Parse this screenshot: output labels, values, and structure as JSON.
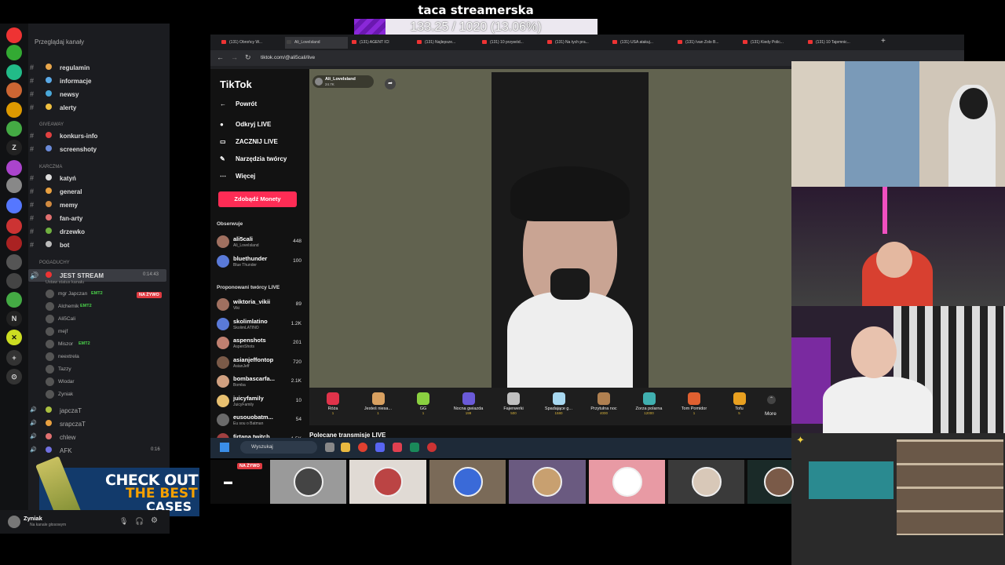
{
  "goal": {
    "title": "taca streamerska",
    "text": "133.25 / 1020 (13.06%)",
    "fraction": 0.1306
  },
  "discord": {
    "browse": "Przeglądaj kanały",
    "channels": [
      {
        "label": "regulamin",
        "color": "#e8a64b"
      },
      {
        "label": "informacje",
        "color": "#5aa9e6"
      },
      {
        "label": "newsy",
        "color": "#4aa8d8"
      },
      {
        "label": "alerty",
        "color": "#f0c040"
      }
    ],
    "cat_giveaway": "GIVEAWAY",
    "giveaway": [
      {
        "label": "konkurs-info",
        "color": "#e04040"
      },
      {
        "label": "screenshoty",
        "color": "#6a8ad8"
      }
    ],
    "cat_karczma": "KARCZMA",
    "karczma": [
      {
        "label": "katyń",
        "color": "#dddddd"
      },
      {
        "label": "general",
        "color": "#e8a040"
      },
      {
        "label": "memy",
        "color": "#d08a40"
      },
      {
        "label": "fan-arty",
        "color": "#e07070"
      },
      {
        "label": "drzewko",
        "color": "#70b040"
      },
      {
        "label": "bot",
        "color": "#bbbbbb"
      }
    ],
    "cat_pogaduchy": "POGADUCHY",
    "voice_active": "JEST STREAM",
    "voice_active_sub": "Ustaw status kanału",
    "voice_time": "0:14:43",
    "live_badge": "NA ŻYWO",
    "voice_users": [
      "mgr Japczan",
      "Alchemik",
      "Ali5Cali",
      "mejf",
      "Miszor",
      "neextrela",
      "Tazzy",
      "Wlodar",
      "Zyniak"
    ],
    "emt": "EMT2",
    "voice_others": [
      "japczaT",
      "srapczaT",
      "chlew",
      "AFK"
    ],
    "afk_time": "0:16",
    "user_name": "Zyniak",
    "user_status": "Na kanale głosowym"
  },
  "browser": {
    "tabs": [
      "(131) Obrońcy W...",
      "Ali_LoveIsland",
      "(131) AGENT ICI",
      "(131) Najlepsze...",
      "(131) 10 przywód...",
      "(131) Na tych pra...",
      "(131) USA atakuj...",
      "(131) Ivan Zolo B...",
      "(131) Kiedy Polic...",
      "(131) 10 Tajemnic..."
    ],
    "url": "tiktok.com/@ali5cali/live"
  },
  "tiktok": {
    "logo": "TikTok",
    "nav": [
      "Powrót",
      "Odkryj LIVE",
      "ZACZNIJ LIVE",
      "Narzędzia twórcy",
      "Więcej"
    ],
    "coins": "Zdobądź Monety",
    "following_title": "Obserwuje",
    "following": [
      {
        "name": "ali5cali",
        "sub": "Ali_LoveIsland",
        "count": "448"
      },
      {
        "name": "bluethunder",
        "sub": "Blue Thunder",
        "count": "100"
      }
    ],
    "suggested_title": "Proponowani twórcy LIVE",
    "suggested": [
      {
        "name": "wiktoria_vikii",
        "sub": "Viki",
        "count": "89"
      },
      {
        "name": "skolimlatino",
        "sub": "SkolimLATINO",
        "count": "1.2K"
      },
      {
        "name": "aspenshots",
        "sub": "AspenShots",
        "count": "201"
      },
      {
        "name": "asianjeffontop",
        "sub": "AsianJeff",
        "count": "720"
      },
      {
        "name": "bombascarfa...",
        "sub": "Bomba",
        "count": "2.1K"
      },
      {
        "name": "juicyfamily",
        "sub": "JuicyFamily",
        "count": "10"
      },
      {
        "name": "eusouobatm...",
        "sub": "Eu sou o Batman",
        "count": "54"
      },
      {
        "name": "firtana.twitch",
        "sub": "",
        "count": "1.5K"
      }
    ],
    "streamer": "Ali_LoveIsland",
    "viewers": "24.7K",
    "gifts": [
      {
        "label": "Róża",
        "price": "1",
        "color": "#e0334a"
      },
      {
        "label": "Jesteś niesa...",
        "price": "1",
        "color": "#d8a060"
      },
      {
        "label": "GG",
        "price": "1",
        "color": "#8ad040"
      },
      {
        "label": "Nocna gwiazda",
        "price": "199",
        "color": "#6a5ad8"
      },
      {
        "label": "Fajerwerki",
        "price": "500",
        "color": "#c0c0c0"
      },
      {
        "label": "Spadające g...",
        "price": "1580",
        "color": "#a8d8f0"
      },
      {
        "label": "Przytulna noc",
        "price": "4000",
        "color": "#b08050"
      },
      {
        "label": "Zorza polarna",
        "price": "12000",
        "color": "#40b0b0"
      },
      {
        "label": "Tom Pomidor",
        "price": "1",
        "color": "#e06030"
      },
      {
        "label": "Tofu",
        "price": "5",
        "color": "#e8a020"
      }
    ],
    "more": "More",
    "rec_title": "Polecane transmisje LIVE",
    "strip_live": "NA ŻYWO"
  },
  "taskbar": {
    "search": "Wyszukaj"
  },
  "ad": {
    "line1": "CHECK OUT",
    "line2": "THE BEST",
    "line3": "CASES"
  }
}
